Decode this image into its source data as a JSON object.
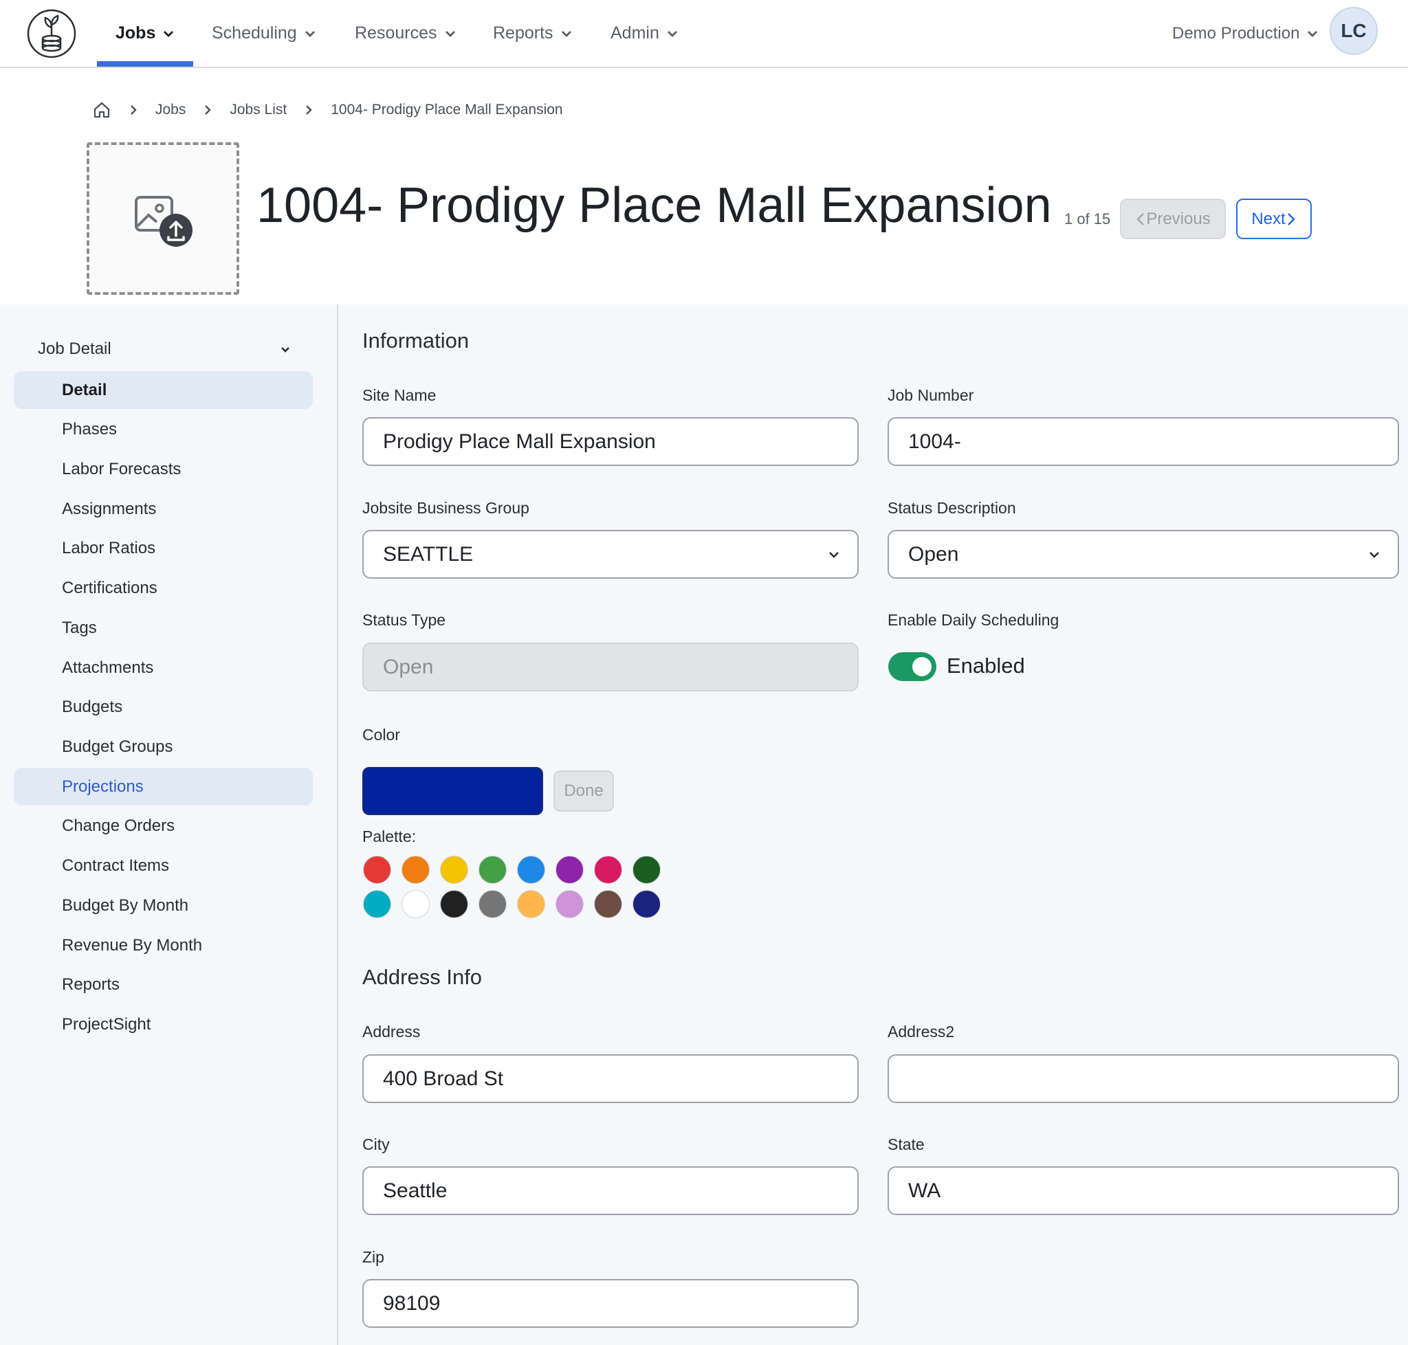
{
  "nav": {
    "items": [
      {
        "label": "Jobs",
        "active": true
      },
      {
        "label": "Scheduling"
      },
      {
        "label": "Resources"
      },
      {
        "label": "Reports"
      },
      {
        "label": "Admin"
      }
    ],
    "org": "Demo Production",
    "avatar": "LC",
    "accent_color": "#3a6fd8"
  },
  "breadcrumb": [
    "Jobs",
    "Jobs List",
    "1004- Prodigy Place Mall Expansion"
  ],
  "header": {
    "title": "1004- Prodigy Place Mall Expansion",
    "pager": "1 of 15",
    "previous": "Previous",
    "next": "Next",
    "image_icon": "image-upload-icon"
  },
  "sidebar": {
    "group": "Job Detail",
    "items": [
      "Detail",
      "Phases",
      "Labor Forecasts",
      "Assignments",
      "Labor Ratios",
      "Certifications",
      "Tags",
      "Attachments",
      "Budgets",
      "Budget Groups",
      "Projections",
      "Change Orders",
      "Contract Items",
      "Budget By Month",
      "Revenue By Month",
      "Reports",
      "ProjectSight"
    ],
    "active": "Detail",
    "selected": "Projections"
  },
  "form": {
    "information_title": "Information",
    "site_name": {
      "label": "Site Name",
      "value": "Prodigy Place Mall Expansion"
    },
    "job_number": {
      "label": "Job Number",
      "value": "1004-"
    },
    "business_group": {
      "label": "Jobsite Business Group",
      "value": "SEATTLE"
    },
    "status_description": {
      "label": "Status Description",
      "value": "Open"
    },
    "status_type": {
      "label": "Status Type",
      "value": "Open"
    },
    "daily_scheduling": {
      "label": "Enable Daily Scheduling",
      "value": "Enabled",
      "on": true
    },
    "color": {
      "label": "Color",
      "value": "#00229e",
      "done": "Done",
      "palette_label": "Palette:"
    },
    "palette": [
      "#e53935",
      "#ef7d0f",
      "#f5c400",
      "#43a047",
      "#1e88e5",
      "#8e24aa",
      "#d81b60",
      "#1b5e20",
      "#00acc1",
      "#ffffff",
      "#212121",
      "#757575",
      "#ffb74d",
      "#ce93d8",
      "#6d4c41",
      "#1a237e"
    ],
    "address_title": "Address Info",
    "address": {
      "label": "Address",
      "value": "400 Broad St"
    },
    "address2": {
      "label": "Address2",
      "value": ""
    },
    "city": {
      "label": "City",
      "value": "Seattle"
    },
    "state": {
      "label": "State",
      "value": "WA"
    },
    "zip": {
      "label": "Zip",
      "value": "98109"
    }
  }
}
